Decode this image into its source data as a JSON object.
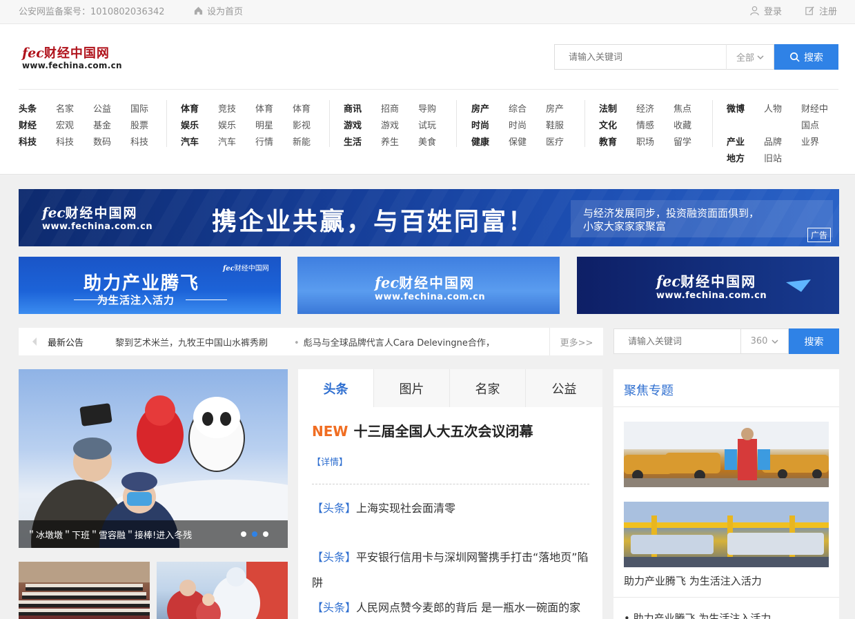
{
  "topbar": {
    "record": "公安网监备案号：1010802036342",
    "set_home": "设为首页",
    "login": "登录",
    "register": "注册"
  },
  "logo": {
    "mark": "fec",
    "name": "财经中国网",
    "url": "www.fechina.com.cn"
  },
  "search_top": {
    "placeholder": "请输入关键词",
    "scope": "全部",
    "button": "搜索"
  },
  "nav": [
    {
      "rows": [
        [
          "头条",
          "名家",
          "公益",
          "国际"
        ],
        [
          "财经",
          "宏观",
          "基金",
          "股票"
        ],
        [
          "科技",
          "科技",
          "数码",
          "科技"
        ]
      ]
    },
    {
      "rows": [
        [
          "体育",
          "竞技",
          "体育",
          "体育"
        ],
        [
          "娱乐",
          "娱乐",
          "明星",
          "影视"
        ],
        [
          "汽车",
          "汽车",
          "行情",
          "新能"
        ]
      ]
    },
    {
      "rows": [
        [
          "商讯",
          "招商",
          "导购"
        ],
        [
          "游戏",
          "游戏",
          "试玩"
        ],
        [
          "生活",
          "养生",
          "美食"
        ]
      ]
    },
    {
      "rows": [
        [
          "房产",
          "综合",
          "房产"
        ],
        [
          "时尚",
          "时尚",
          "鞋服"
        ],
        [
          "健康",
          "保健",
          "医疗"
        ]
      ]
    },
    {
      "rows": [
        [
          "法制",
          "经济",
          "焦点"
        ],
        [
          "文化",
          "情感",
          "收藏"
        ],
        [
          "教育",
          "职场",
          "留学"
        ]
      ]
    },
    {
      "rows": [
        [
          "微博",
          "人物",
          "财经中"
        ],
        [
          "",
          "",
          "国点"
        ],
        [
          "产业",
          "品牌",
          "业界"
        ],
        [
          "地方",
          "旧站",
          ""
        ]
      ]
    }
  ],
  "banner_wide": {
    "brand_name": "财经中国网",
    "brand_url": "www.fechina.com.cn",
    "slogan": "携企业共赢，与百姓同富！",
    "sub_line1": "与经济发展同步，投资融资面面俱到，",
    "sub_line2": "小家大家家家聚富",
    "ad_label": "广告"
  },
  "banner_small": [
    {
      "big": "助力产业腾飞",
      "small": "为生活注入活力",
      "mini": "财经中国网"
    },
    {
      "brand_name": "财经中国网",
      "brand_url": "www.fechina.com.cn"
    },
    {
      "brand_name": "财经中国网",
      "brand_url": "www.fechina.com.cn"
    }
  ],
  "notice": {
    "title": "最新公告",
    "items": [
      "黎到艺术米兰，九牧王中国山水裤秀刷",
      "彪马与全球品牌代言人Cara Delevingne合作，"
    ],
    "more": "更多>>"
  },
  "search_2": {
    "placeholder": "请输入关键词",
    "scope": "360",
    "button": "搜索"
  },
  "slider": {
    "caption": "＂冰墩墩＂下班＂雪容融＂接棒!进入冬残",
    "dots": 3,
    "active_dot": 1
  },
  "tabs": {
    "items": [
      "头条",
      "图片",
      "名家",
      "公益"
    ],
    "active": 0,
    "new_label": "NEW",
    "headline": "十三届全国人大五次会议闭幕",
    "detail": "【详情】",
    "news": [
      {
        "tag": "【头条】",
        "text": "上海实现社会面清零"
      },
      {
        "tag": "【头条】",
        "text": "平安银行信用卡与深圳网警携手打击“落地页”陷阱"
      },
      {
        "tag": "【头条】",
        "text": "人民网点赞今麦郎的背后 是一瓶水一碗面的家"
      }
    ]
  },
  "focus": {
    "title": "聚焦专题",
    "caption": "助力产业腾飞 为生活注入活力",
    "list_item": "助力产业腾飞 为生活注入活力"
  },
  "colors": {
    "accent": "#2f82e6",
    "brand_red": "#b0121b",
    "new_orange": "#f06d22"
  }
}
